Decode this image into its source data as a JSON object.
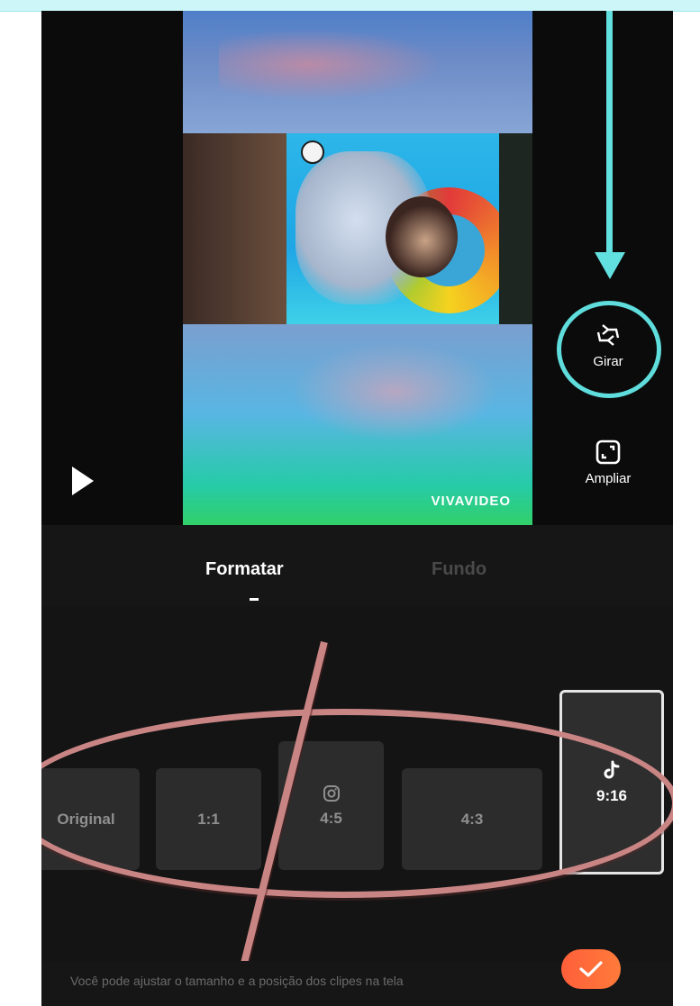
{
  "preview": {
    "watermark": "VIVAVIDEO"
  },
  "tools": {
    "rotate_label": "Girar",
    "zoom_label": "Ampliar"
  },
  "tabs": [
    {
      "label": "Formatar",
      "active": true
    },
    {
      "label": "Fundo",
      "active": false
    }
  ],
  "ratios": [
    {
      "label": "Original",
      "icon": "",
      "selected": false
    },
    {
      "label": "1:1",
      "icon": "",
      "selected": false
    },
    {
      "label": "4:5",
      "icon": "instagram-icon",
      "selected": false
    },
    {
      "label": "4:3",
      "icon": "",
      "selected": false
    },
    {
      "label": "9:16",
      "icon": "tiktok-icon",
      "selected": true
    }
  ],
  "footer": {
    "hint": "Você pode ajustar o tamanho e a posição dos clipes na tela",
    "confirm_icon": "check-icon"
  },
  "colors": {
    "annotation_cyan": "#62e0e0",
    "annotation_red": "#c98584",
    "confirm_orange": "#ff6a3a",
    "background": "#0b0b0b"
  }
}
